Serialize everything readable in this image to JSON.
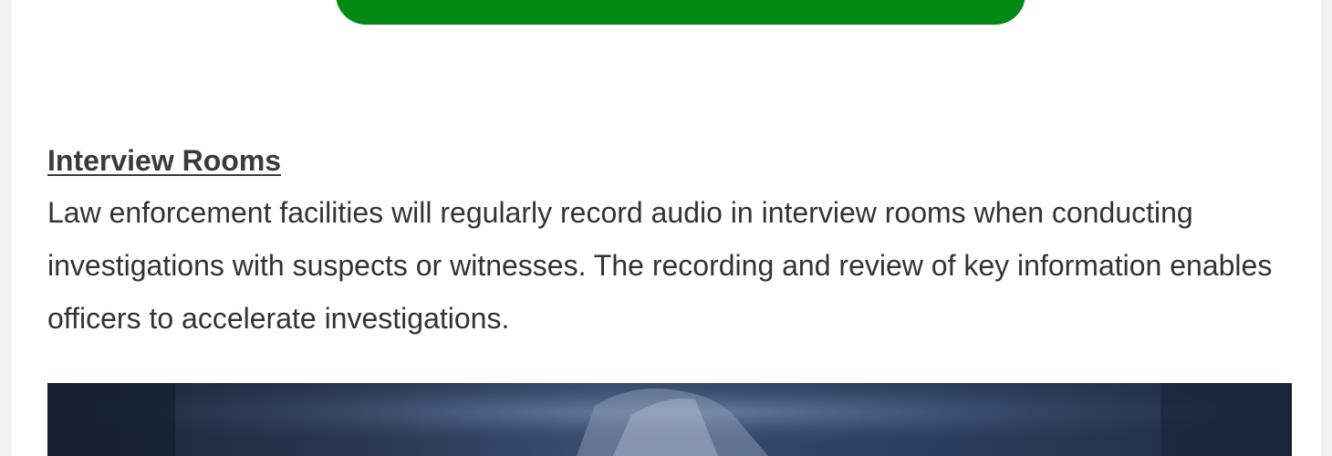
{
  "cta": {
    "label": "",
    "color": "#008a14"
  },
  "section": {
    "heading": "Interview Rooms",
    "body": "Law enforcement facilities will regularly record audio in interview rooms when conducting investigations with suspects or witnesses. The recording and review of key information enables officers to accelerate investigations."
  },
  "image": {
    "subject": "interview-room-photo"
  }
}
